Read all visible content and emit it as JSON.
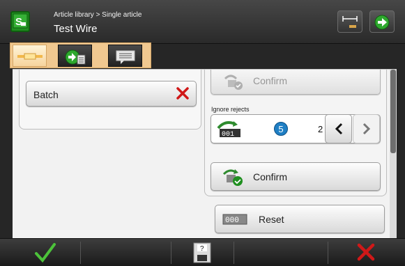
{
  "header": {
    "breadcrumb": "Article library > Single article",
    "title": "Test Wire"
  },
  "tabs": [
    {
      "icon": "wire-icon",
      "active": true
    },
    {
      "icon": "process-icon",
      "active": false
    },
    {
      "icon": "message-icon",
      "active": false
    }
  ],
  "left_panel": {
    "batch_label": "Batch"
  },
  "right_panel": {
    "confirm_top_label": "Confirm",
    "ignore_rejects_label": "Ignore rejects",
    "counter_icon_text": "001",
    "badge_number": "5",
    "counter_value": "2",
    "confirm_label": "Confirm",
    "reset_icon_text": "000",
    "reset_label": "Reset"
  },
  "footer": {
    "save_icon_text": "?"
  },
  "colors": {
    "accent_green": "#1f8f1f",
    "badge_blue": "#1f7fc4",
    "cancel_red": "#d01818",
    "tab_orange": "#f0c890"
  }
}
